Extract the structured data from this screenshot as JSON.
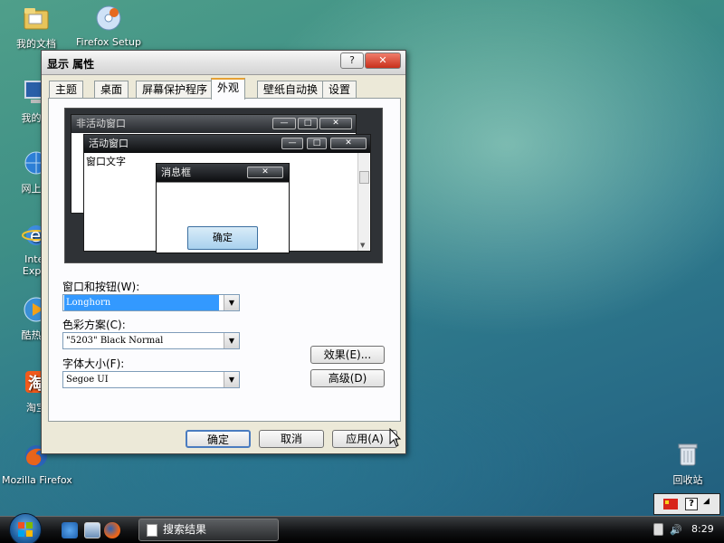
{
  "desktop": {
    "icons": [
      {
        "label": "我的文档"
      },
      {
        "label": "Firefox Setup"
      },
      {
        "label": "我的电"
      },
      {
        "label": "网上邻"
      },
      {
        "label": "Inter"
      },
      {
        "label": "Explo"
      },
      {
        "label": "酷热影"
      },
      {
        "label": "淘宝"
      },
      {
        "label": "Mozilla Firefox"
      },
      {
        "label": "回收站"
      }
    ]
  },
  "dialog": {
    "title": "显示 属性",
    "help_label": "?",
    "close_label": "✕",
    "tabs": [
      {
        "label": "主题"
      },
      {
        "label": "桌面"
      },
      {
        "label": "屏幕保护程序"
      },
      {
        "label": "外观"
      },
      {
        "label": "壁纸自动换"
      },
      {
        "label": "设置"
      }
    ],
    "active_tab": "外观",
    "preview": {
      "inactive_window_title": "非活动窗口",
      "active_window_title": "活动窗口",
      "window_text": "窗口文字",
      "message_box_title": "消息框",
      "message_box_ok": "确定"
    },
    "fields": {
      "windows_buttons_label": "窗口和按钮(W):",
      "windows_buttons_value": "Longhorn",
      "color_scheme_label": "色彩方案(C):",
      "color_scheme_value": "\"5203\" Black Normal",
      "font_size_label": "字体大小(F):",
      "font_size_value": "Segoe UI"
    },
    "buttons": {
      "effects": "效果(E)...",
      "advanced": "高级(D)",
      "ok": "确定",
      "cancel": "取消",
      "apply": "应用(A)"
    }
  },
  "taskbar": {
    "task_button_label": "搜索结果",
    "clock": "8:29"
  },
  "colors": {
    "selection": "#3399ff",
    "dialog_face": "#ece9d8",
    "close_red": "#c8301c",
    "preview_bg": "#2f3236"
  }
}
